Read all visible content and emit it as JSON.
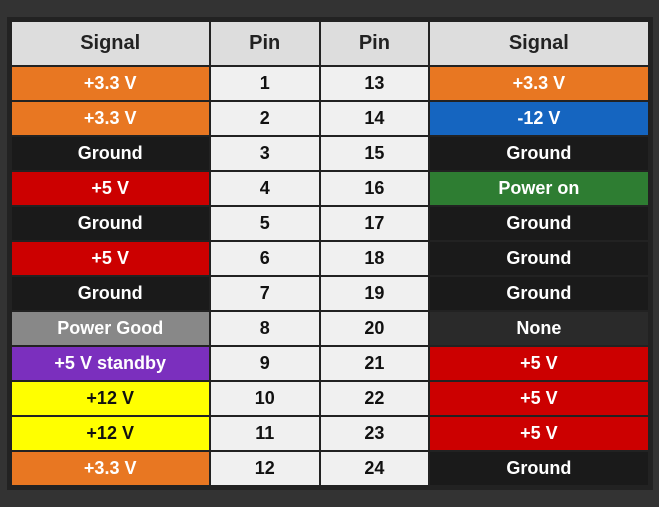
{
  "header": {
    "col1": "Signal",
    "col2": "Pin",
    "col3": "Pin",
    "col4": "Signal"
  },
  "rows": [
    {
      "left_signal": "+3.3 V",
      "left_class": "orange",
      "pin_left": "1",
      "pin_right": "13",
      "right_signal": "+3.3 V",
      "right_class": "orange"
    },
    {
      "left_signal": "+3.3 V",
      "left_class": "orange",
      "pin_left": "2",
      "pin_right": "14",
      "right_signal": "-12 V",
      "right_class": "blue"
    },
    {
      "left_signal": "Ground",
      "left_class": "black",
      "pin_left": "3",
      "pin_right": "15",
      "right_signal": "Ground",
      "right_class": "black"
    },
    {
      "left_signal": "+5 V",
      "left_class": "red",
      "pin_left": "4",
      "pin_right": "16",
      "right_signal": "Power on",
      "right_class": "green"
    },
    {
      "left_signal": "Ground",
      "left_class": "black",
      "pin_left": "5",
      "pin_right": "17",
      "right_signal": "Ground",
      "right_class": "black"
    },
    {
      "left_signal": "+5 V",
      "left_class": "red",
      "pin_left": "6",
      "pin_right": "18",
      "right_signal": "Ground",
      "right_class": "black"
    },
    {
      "left_signal": "Ground",
      "left_class": "black",
      "pin_left": "7",
      "pin_right": "19",
      "right_signal": "Ground",
      "right_class": "black"
    },
    {
      "left_signal": "Power Good",
      "left_class": "gray",
      "pin_left": "8",
      "pin_right": "20",
      "right_signal": "None",
      "right_class": "dark"
    },
    {
      "left_signal": "+5 V standby",
      "left_class": "purple",
      "pin_left": "9",
      "pin_right": "21",
      "right_signal": "+5 V",
      "right_class": "red"
    },
    {
      "left_signal": "+12 V",
      "left_class": "yellow",
      "pin_left": "10",
      "pin_right": "22",
      "right_signal": "+5 V",
      "right_class": "red"
    },
    {
      "left_signal": "+12 V",
      "left_class": "yellow",
      "pin_left": "11",
      "pin_right": "23",
      "right_signal": "+5 V",
      "right_class": "red"
    },
    {
      "left_signal": "+3.3 V",
      "left_class": "orange",
      "pin_left": "12",
      "pin_right": "24",
      "right_signal": "Ground",
      "right_class": "black"
    }
  ]
}
